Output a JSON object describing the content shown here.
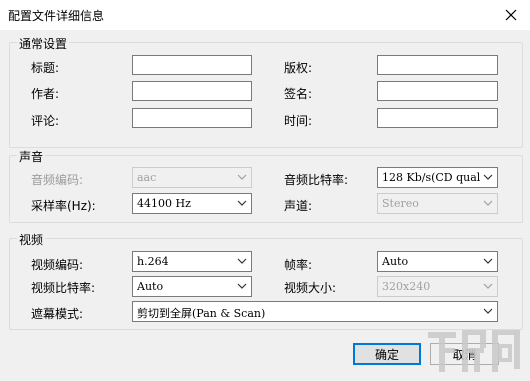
{
  "window": {
    "title": "配置文件详细信息"
  },
  "general": {
    "legend": "通常设置",
    "title_label": "标题:",
    "author_label": "作者:",
    "comment_label": "评论:",
    "copyright_label": "版权:",
    "signature_label": "签名:",
    "time_label": "时间:",
    "title_value": "",
    "author_value": "",
    "comment_value": "",
    "copyright_value": "",
    "signature_value": "",
    "time_value": ""
  },
  "audio": {
    "legend": "声音",
    "codec_label": "音频编码:",
    "codec_value": "aac",
    "bitrate_label": "音频比特率:",
    "bitrate_value": "128 Kb/s(CD qual",
    "samplerate_label": "采样率(Hz):",
    "samplerate_value": "44100 Hz",
    "channel_label": "声道:",
    "channel_value": "Stereo"
  },
  "video": {
    "legend": "视频",
    "codec_label": "视频编码:",
    "codec_value": "h.264",
    "framerate_label": "帧率:",
    "framerate_value": "Auto",
    "bitrate_label": "视频比特率:",
    "bitrate_value": "Auto",
    "size_label": "视频大小:",
    "size_value": "320x240",
    "mask_label": "遮幕模式:",
    "mask_value": "剪切到全屏(Pan & Scan)"
  },
  "buttons": {
    "ok": "确定",
    "cancel": "取消"
  },
  "watermark": {
    "text": "下载吧"
  },
  "colors": {
    "default_button_border": "#0078d7",
    "group_border": "#dcdcdc"
  },
  "icons": {
    "close": "close-icon",
    "dropdown": "chevron-down-icon"
  }
}
